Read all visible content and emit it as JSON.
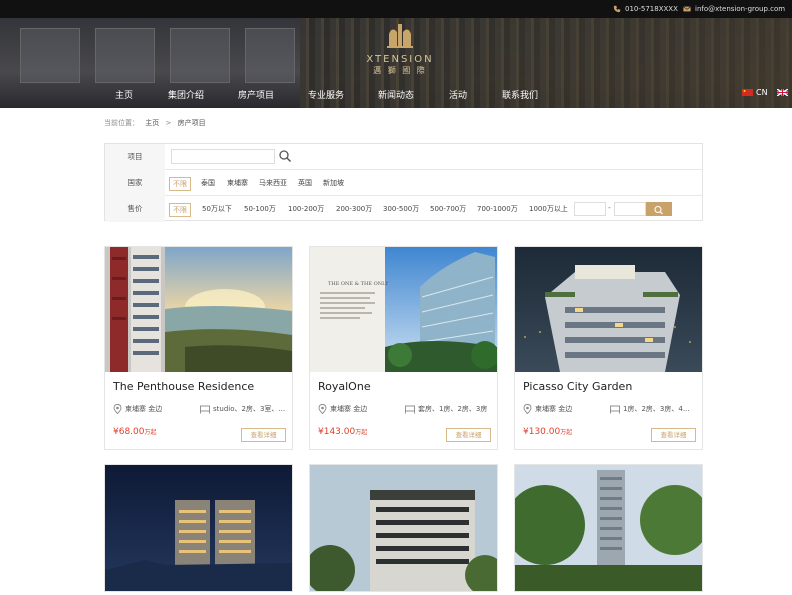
{
  "topbar": {
    "phone": "010-5718XXXX",
    "email": "info@xtension-group.com"
  },
  "logo": {
    "name": "XTENSION",
    "cn": "邁 獅 國 際"
  },
  "nav": [
    "主页",
    "集团介绍",
    "房产项目",
    "专业服务",
    "新闻动态",
    "活动",
    "联系我们"
  ],
  "lang": {
    "cn": "CN"
  },
  "breadcrumb": {
    "prefix": "当前位置：",
    "home": "主页",
    "sep": ">",
    "current": "房产项目"
  },
  "filters": {
    "project_label": "项目",
    "country_label": "国家",
    "countries": [
      "不限",
      "泰国",
      "柬埔寨",
      "马来西亚",
      "英国",
      "新加坡"
    ],
    "price_label": "售价",
    "prices": [
      "不限",
      "50万以下",
      "50-100万",
      "100-200万",
      "200-300万",
      "300-500万",
      "500-700万",
      "700-1000万",
      "1000万以上"
    ],
    "dash": "-"
  },
  "cards": [
    {
      "title": "The Penthouse Residence",
      "location": "柬埔寨 金边",
      "rooms": "studio、2房、3室、...",
      "price": "¥68.00",
      "unit": "万起",
      "detail": "查看详细"
    },
    {
      "title": "RoyalOne",
      "location": "柬埔寨 金边",
      "rooms": "套房、1房、2房、3房",
      "price": "¥143.00",
      "unit": "万起",
      "detail": "查看详细"
    },
    {
      "title": "Picasso City Garden",
      "location": "柬埔寨 金边",
      "rooms": "1房、2房、3房、4...",
      "price": "¥130.00",
      "unit": "万起",
      "detail": "查看详细"
    }
  ],
  "royal_brochure": {
    "line1": "THE ONE & THE ONLY"
  },
  "colors": {
    "accent": "#c9a26a",
    "price": "#e0402a",
    "topbar": "#111111"
  }
}
